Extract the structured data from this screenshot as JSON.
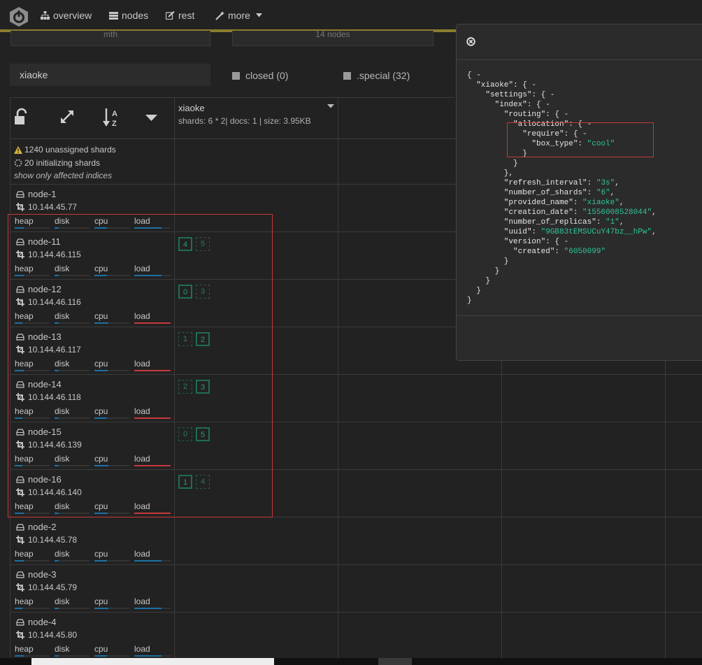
{
  "nav": {
    "items": [
      {
        "label": "overview",
        "icon": "sitemap-icon"
      },
      {
        "label": "nodes",
        "icon": "server-stack-icon"
      },
      {
        "label": "rest",
        "icon": "edit-icon"
      },
      {
        "label": "more",
        "icon": "magic-wand-icon"
      }
    ]
  },
  "stubs": [
    "mth",
    "14 nodes"
  ],
  "filter": {
    "value": "xiaoke",
    "placeholder": ""
  },
  "checkboxes": {
    "closed": "closed (0)",
    "special": ".special (32)"
  },
  "index": {
    "name": "xiaoke",
    "stats": "shards: 6 * 2| docs: 1 | size: 3.95KB"
  },
  "cluster": {
    "unassigned": "1240 unassigned shards",
    "initializing": "20 initializing shards",
    "hint": "show only affected indices"
  },
  "metric_labels": [
    "heap",
    "disk",
    "cpu",
    "load"
  ],
  "colors": {
    "accent": "#8a7d2e",
    "bar_blue": "#1d6fa5",
    "bar_red": "#c53a3a",
    "shard_green": "#1f6e52",
    "json_string": "#2fc49a"
  },
  "nodes": [
    {
      "name": "node-1",
      "ip": "10.144.45.77",
      "load_state": "normal",
      "shards": []
    },
    {
      "name": "node-11",
      "ip": "10.144.46.115",
      "load_state": "normal",
      "shards": [
        {
          "n": "4",
          "kind": "primary"
        },
        {
          "n": "5",
          "kind": "replica"
        }
      ]
    },
    {
      "name": "node-12",
      "ip": "10.144.46.116",
      "load_state": "high",
      "shards": [
        {
          "n": "0",
          "kind": "primary"
        },
        {
          "n": "3",
          "kind": "replica"
        }
      ]
    },
    {
      "name": "node-13",
      "ip": "10.144.46.117",
      "load_state": "high",
      "shards": [
        {
          "n": "1",
          "kind": "replica"
        },
        {
          "n": "2",
          "kind": "primary"
        }
      ]
    },
    {
      "name": "node-14",
      "ip": "10.144.46.118",
      "load_state": "high",
      "shards": [
        {
          "n": "2",
          "kind": "replica"
        },
        {
          "n": "3",
          "kind": "primary"
        }
      ]
    },
    {
      "name": "node-15",
      "ip": "10.144.46.139",
      "load_state": "high",
      "shards": [
        {
          "n": "0",
          "kind": "replica"
        },
        {
          "n": "5",
          "kind": "primary"
        }
      ]
    },
    {
      "name": "node-16",
      "ip": "10.144.46.140",
      "load_state": "high",
      "shards": [
        {
          "n": "1",
          "kind": "primary"
        },
        {
          "n": "4",
          "kind": "replica"
        }
      ]
    },
    {
      "name": "node-2",
      "ip": "10.144.45.78",
      "load_state": "normal",
      "shards": []
    },
    {
      "name": "node-3",
      "ip": "10.144.45.79",
      "load_state": "normal",
      "shards": []
    },
    {
      "name": "node-4",
      "ip": "10.144.45.80",
      "load_state": "normal",
      "shards": []
    }
  ],
  "json_lines": [
    [
      {
        "t": "{ -"
      }
    ],
    [
      {
        "t": "  \"xiaoke\": { -"
      }
    ],
    [
      {
        "t": "    \"settings\": { -"
      }
    ],
    [
      {
        "t": "      \"index\": { -"
      }
    ],
    [
      {
        "t": "        \"routing\": { -"
      }
    ],
    [
      {
        "t": "          \"allocation\": { -"
      }
    ],
    [
      {
        "t": "            \"require\": { -"
      }
    ],
    [
      {
        "t": "              \"box_type\": "
      },
      {
        "t": "\"cool\"",
        "s": true
      }
    ],
    [
      {
        "t": "            }"
      }
    ],
    [
      {
        "t": "          }"
      }
    ],
    [
      {
        "t": "        },"
      }
    ],
    [
      {
        "t": "        \"refresh_interval\": "
      },
      {
        "t": "\"3s\"",
        "s": true
      },
      {
        "t": ","
      }
    ],
    [
      {
        "t": "        \"number_of_shards\": "
      },
      {
        "t": "\"6\"",
        "s": true
      },
      {
        "t": ","
      }
    ],
    [
      {
        "t": "        \"provided_name\": "
      },
      {
        "t": "\"xiaoke\"",
        "s": true
      },
      {
        "t": ","
      }
    ],
    [
      {
        "t": "        \"creation_date\": "
      },
      {
        "t": "\"1556008528044\"",
        "s": true
      },
      {
        "t": ","
      }
    ],
    [
      {
        "t": "        \"number_of_replicas\": "
      },
      {
        "t": "\"1\"",
        "s": true
      },
      {
        "t": ","
      }
    ],
    [
      {
        "t": "        \"uuid\": "
      },
      {
        "t": "\"9GB83tEMSUCuY47bz__hPw\"",
        "s": true
      },
      {
        "t": ","
      }
    ],
    [
      {
        "t": "        \"version\": { -"
      }
    ],
    [
      {
        "t": "          \"created\": "
      },
      {
        "t": "\"6050099\"",
        "s": true
      }
    ],
    [
      {
        "t": "        }"
      }
    ],
    [
      {
        "t": "      }"
      }
    ],
    [
      {
        "t": "    }"
      }
    ],
    [
      {
        "t": "  }"
      }
    ],
    [
      {
        "t": "}"
      }
    ]
  ]
}
